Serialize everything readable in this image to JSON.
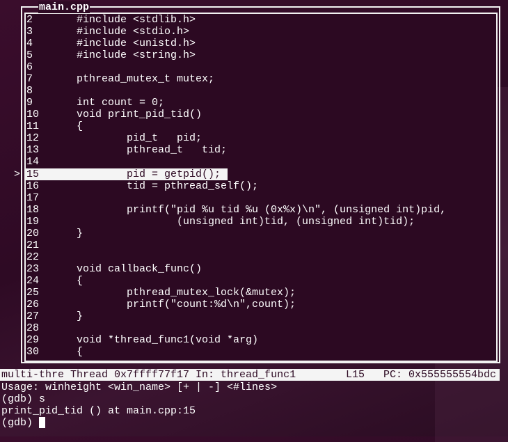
{
  "source_window": {
    "title": "main.cpp",
    "current_line_marker": ">",
    "current_line": "15",
    "lines": [
      {
        "n": "2",
        "code": "#include <stdlib.h>"
      },
      {
        "n": "3",
        "code": "#include <stdio.h>"
      },
      {
        "n": "4",
        "code": "#include <unistd.h>"
      },
      {
        "n": "5",
        "code": "#include <string.h>"
      },
      {
        "n": "6",
        "code": ""
      },
      {
        "n": "7",
        "code": "pthread_mutex_t mutex;"
      },
      {
        "n": "8",
        "code": ""
      },
      {
        "n": "9",
        "code": "int count = 0;"
      },
      {
        "n": "10",
        "code": "void print_pid_tid()"
      },
      {
        "n": "11",
        "code": "{"
      },
      {
        "n": "12",
        "code": "        pid_t   pid;"
      },
      {
        "n": "13",
        "code": "        pthread_t   tid;"
      },
      {
        "n": "14",
        "code": ""
      },
      {
        "n": "15",
        "code": "        pid = getpid();"
      },
      {
        "n": "16",
        "code": "        tid = pthread_self();"
      },
      {
        "n": "17",
        "code": ""
      },
      {
        "n": "18",
        "code": "        printf(\"pid %u tid %u (0x%x)\\n\", (unsigned int)pid,"
      },
      {
        "n": "19",
        "code": "                (unsigned int)tid, (unsigned int)tid);"
      },
      {
        "n": "20",
        "code": "}"
      },
      {
        "n": "21",
        "code": ""
      },
      {
        "n": "22",
        "code": ""
      },
      {
        "n": "23",
        "code": "void callback_func()"
      },
      {
        "n": "24",
        "code": "{"
      },
      {
        "n": "25",
        "code": "        pthread_mutex_lock(&mutex);"
      },
      {
        "n": "26",
        "code": "        printf(\"count:%d\\n\",count);"
      },
      {
        "n": "27",
        "code": "}"
      },
      {
        "n": "28",
        "code": ""
      },
      {
        "n": "29",
        "code": "void *thread_func1(void *arg)"
      },
      {
        "n": "30",
        "code": "{"
      }
    ]
  },
  "status_bar": {
    "target": "multi-thre Thread 0x7ffff77f17 In: thread_func1",
    "line": "L15",
    "pc": "PC: 0x555555554bdc"
  },
  "command_window": {
    "lines": [
      "Usage: winheight <win_name> [+ | -] <#lines>",
      "(gdb) s",
      "print_pid_tid () at main.cpp:15"
    ],
    "prompt": "(gdb) "
  }
}
